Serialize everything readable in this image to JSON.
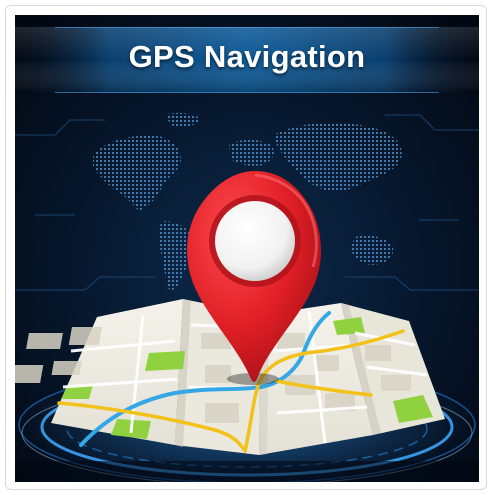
{
  "title": "GPS Navigation",
  "icons": {
    "pin": "map-pin-icon",
    "map": "folded-map-icon",
    "world": "world-map-icon"
  },
  "colors": {
    "background": "#04101f",
    "title_band": "#0a4f86",
    "title_text": "#ffffff",
    "pin_red": "#e01f26",
    "pin_dark": "#b0141a",
    "road_yellow": "#f2c21b",
    "river_blue": "#35a7e6",
    "park_green": "#8fd13f",
    "glow_cyan": "#3fa9ff"
  }
}
